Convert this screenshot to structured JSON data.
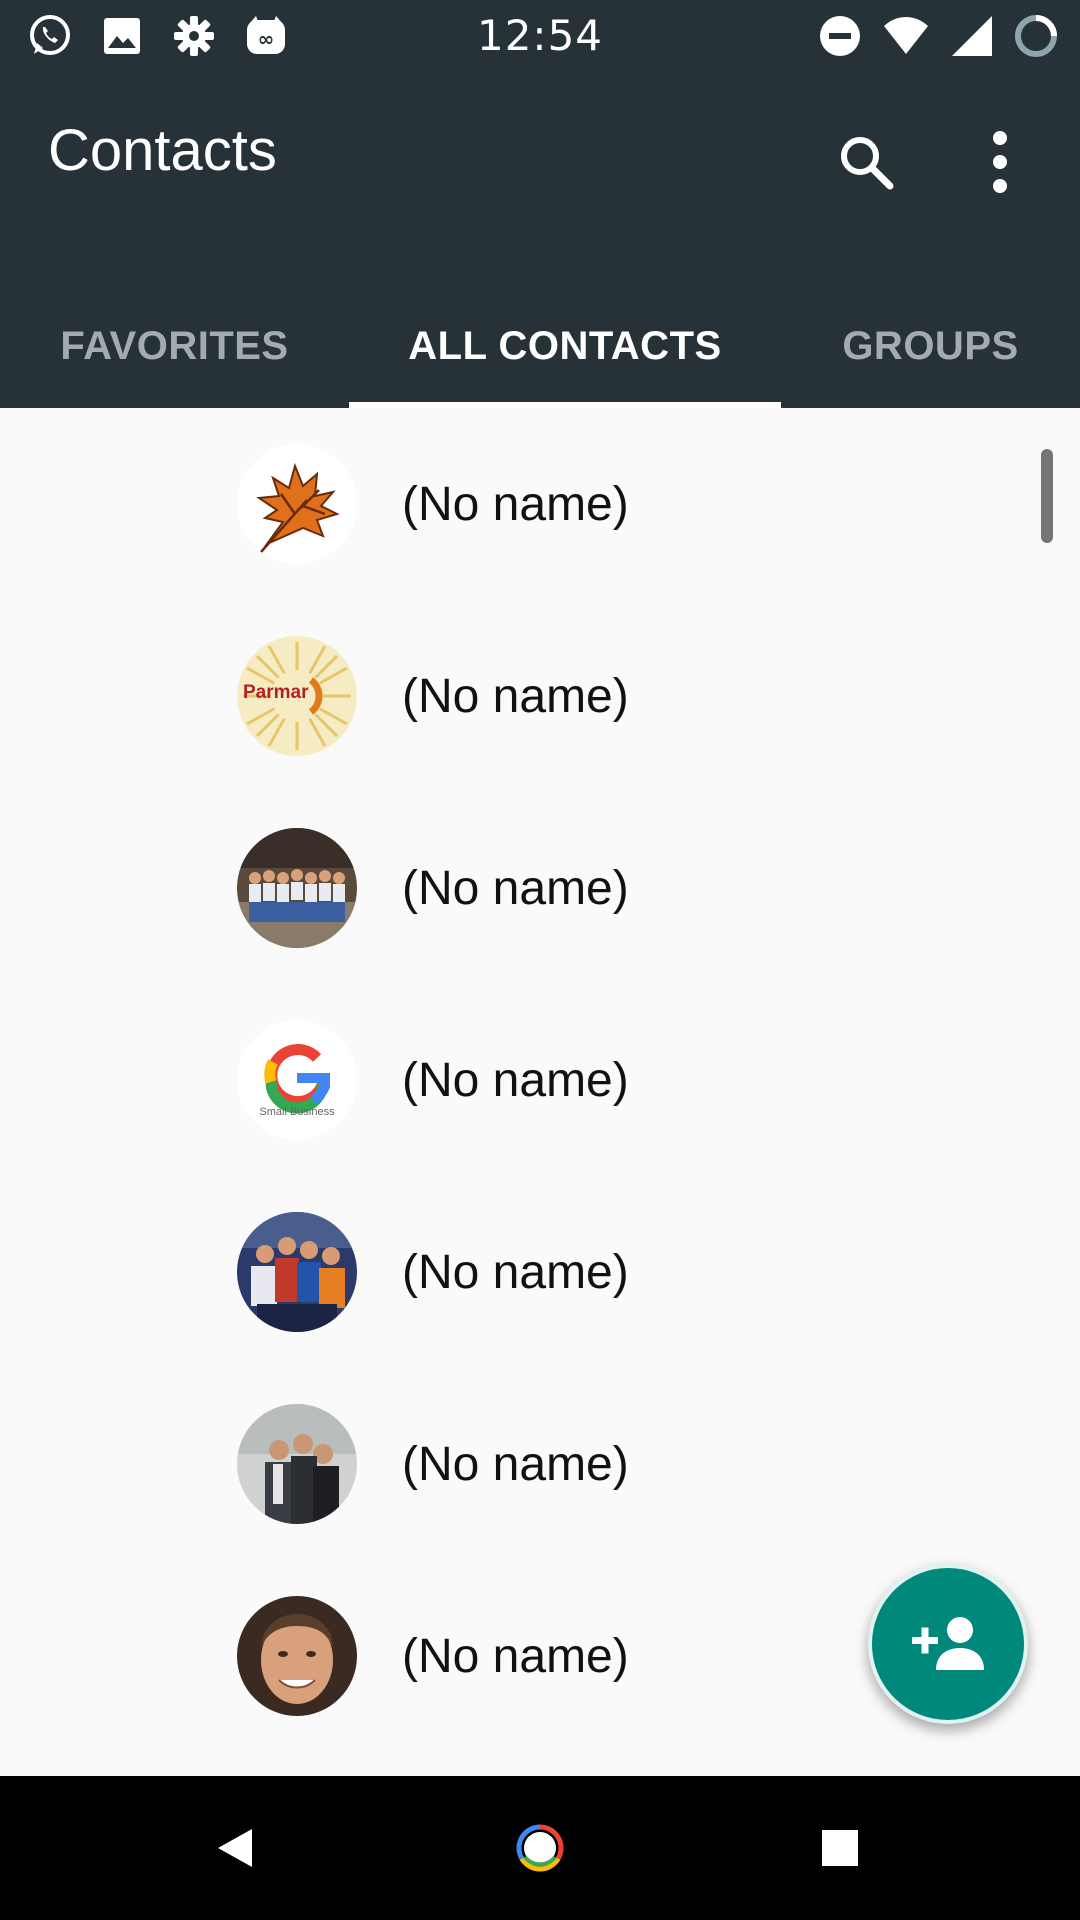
{
  "status_bar": {
    "time": "12:54",
    "left_icons": [
      "whatsapp-icon",
      "gallery-icon",
      "settings-icon",
      "app-icon"
    ],
    "right_icons": [
      "do-not-disturb-icon",
      "wifi-icon",
      "signal-icon",
      "battery-icon"
    ]
  },
  "app_bar": {
    "title": "Contacts",
    "background": "#263238",
    "actions": [
      "search-icon",
      "more-vert-icon"
    ]
  },
  "tabs": [
    {
      "label": "FAVORITES",
      "active": false
    },
    {
      "label": "ALL CONTACTS",
      "active": true
    },
    {
      "label": "GROUPS",
      "active": false
    }
  ],
  "contacts": [
    {
      "name": "(No name)",
      "avatar": "maple-leaf"
    },
    {
      "name": "(No name)",
      "avatar": "parmar-logo",
      "avatar_text": "Parmar"
    },
    {
      "name": "(No name)",
      "avatar": "group-photo"
    },
    {
      "name": "(No name)",
      "avatar": "google-logo",
      "avatar_text": "Small Business"
    },
    {
      "name": "(No name)",
      "avatar": "group-photo"
    },
    {
      "name": "(No name)",
      "avatar": "group-photo"
    },
    {
      "name": "(No name)",
      "avatar": "portrait-photo"
    }
  ],
  "fab": {
    "icon": "add-person-icon",
    "color": "#00897b"
  },
  "nav_bar": {
    "buttons": [
      "back-icon",
      "home-icon",
      "recents-icon"
    ]
  }
}
